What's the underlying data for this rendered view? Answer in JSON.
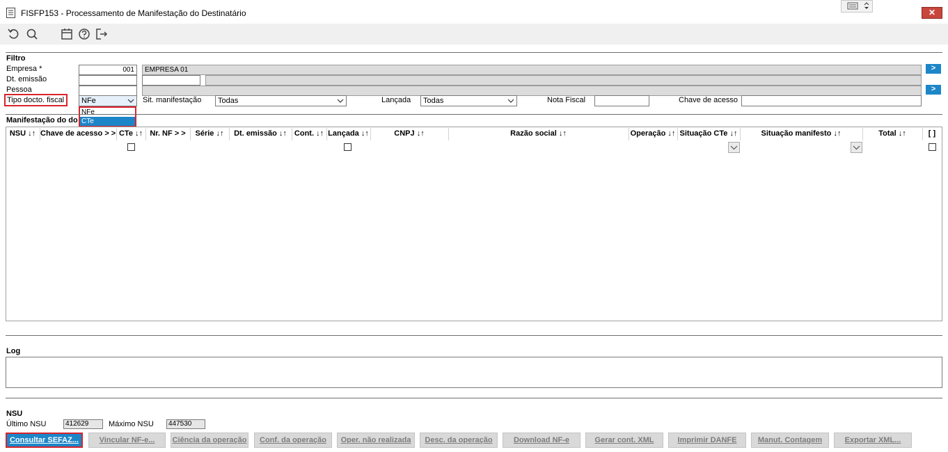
{
  "window": {
    "title": "FISFP153 - Processamento de Manifestação do Destinatário",
    "close_label": "✕"
  },
  "toolbar": {
    "icons": [
      "undo-icon",
      "search-icon",
      "calendar-icon",
      "help-icon",
      "exit-icon"
    ]
  },
  "filtro": {
    "section_label": "Filtro",
    "empresa_label": "Empresa *",
    "empresa_code": "001",
    "empresa_name": "EMPRESA 01",
    "dt_emissao_label": "Dt. emissão",
    "pessoa_label": "Pessoa",
    "tipo_docto_label": "Tipo docto. fiscal",
    "tipo_docto_value": "NFe",
    "tipo_docto_options": [
      "NFe",
      "CTe"
    ],
    "sit_manifestacao_label": "Sit. manifestação",
    "sit_manifestacao_value": "Todas",
    "lancada_label": "Lançada",
    "lancada_value": "Todas",
    "nota_fiscal_label": "Nota Fiscal",
    "chave_acesso_label": "Chave de acesso",
    "go_label": ">"
  },
  "grid": {
    "section_label": "Manifestação do do",
    "columns": [
      "NSU ↓↑",
      "Chave de acesso > >",
      "CTe ↓↑",
      "Nr. NF > >",
      "Série ↓↑",
      "Dt. emissão ↓↑",
      "Cont. ↓↑",
      "Lançada ↓↑",
      "CNPJ ↓↑",
      "Razão social ↓↑",
      "Operação ↓↑",
      "Situação CTe ↓↑",
      "Situação manifesto ↓↑",
      "Total ↓↑",
      "[ ]"
    ]
  },
  "log": {
    "section_label": "Log"
  },
  "nsu": {
    "section_label": "NSU",
    "ultimo_label": "Último NSU",
    "ultimo_value": "412629",
    "maximo_label": "Máximo NSU",
    "maximo_value": "447530"
  },
  "buttons": {
    "consultar": "Consultar SEFAZ...",
    "vincular": "Vincular NF-e...",
    "ciencia": "Ciência da operação",
    "conf": "Conf. da operação",
    "oper_nao": "Oper. não realizada",
    "desc": "Desc. da operação",
    "download": "Download NF-e",
    "gerar": "Gerar cont. XML",
    "imprimir": "Imprimir DANFE",
    "manut": "Manut. Contagem",
    "exportar": "Exportar XML..."
  },
  "colors": {
    "accent": "#1d86c8",
    "highlight": "#d9232b",
    "close": "#c9463d"
  }
}
